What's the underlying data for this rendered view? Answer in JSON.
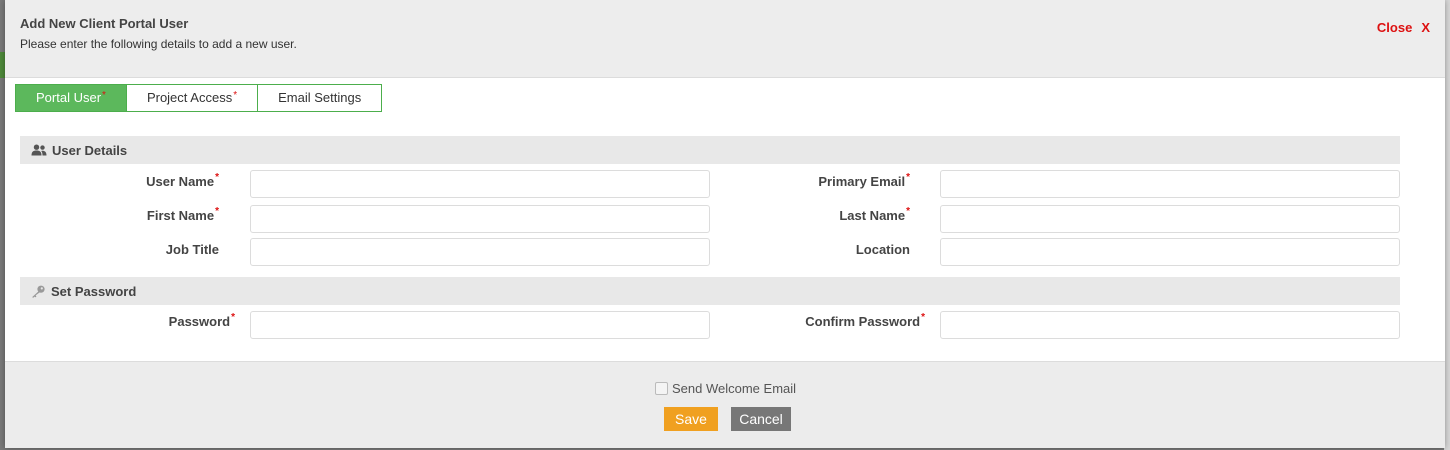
{
  "modal": {
    "title": "Add New Client Portal User",
    "subtitle": "Please enter the following details to add a new user.",
    "close_label": "Close",
    "close_icon": "X"
  },
  "tabs": [
    {
      "label": "Portal User",
      "required": "*",
      "active": true
    },
    {
      "label": "Project Access",
      "required": "*",
      "active": false
    },
    {
      "label": "Email Settings",
      "required": "",
      "active": false
    }
  ],
  "sections": {
    "user_details": {
      "title": "User Details",
      "icon": "users-icon"
    },
    "set_password": {
      "title": "Set Password",
      "icon": "key-icon"
    }
  },
  "fields": {
    "user_name": {
      "label": "User Name",
      "required": "*",
      "value": ""
    },
    "primary_email": {
      "label": "Primary Email",
      "required": "*",
      "value": ""
    },
    "first_name": {
      "label": "First Name",
      "required": "*",
      "value": ""
    },
    "last_name": {
      "label": "Last Name",
      "required": "*",
      "value": ""
    },
    "job_title": {
      "label": "Job Title",
      "required": "",
      "value": ""
    },
    "location": {
      "label": "Location",
      "required": "",
      "value": ""
    },
    "password": {
      "label": "Password",
      "required": "*",
      "value": ""
    },
    "confirm_password": {
      "label": "Confirm Password",
      "required": "*",
      "value": ""
    }
  },
  "footer": {
    "welcome_label": "Send Welcome Email",
    "welcome_checked": false,
    "save_label": "Save",
    "cancel_label": "Cancel"
  },
  "colors": {
    "accent_green": "#5cb85c",
    "required_red": "#dd1111",
    "save_orange": "#f0a020",
    "cancel_gray": "#777777"
  }
}
